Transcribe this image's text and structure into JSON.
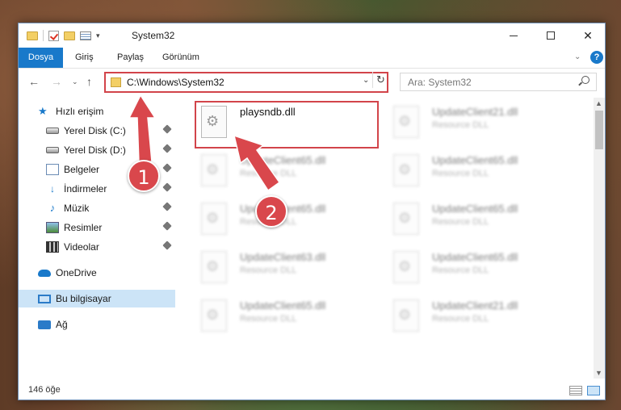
{
  "window": {
    "title": "System32",
    "quick_access_toolbar": [
      "folder-icon",
      "checkmark-icon",
      "folder-icon",
      "properties-icon"
    ]
  },
  "ribbon": {
    "tabs": [
      {
        "label": "Dosya",
        "active": true
      },
      {
        "label": "Giriş"
      },
      {
        "label": "Paylaş"
      },
      {
        "label": "Görünüm"
      }
    ],
    "help": "?"
  },
  "nav": {
    "address": "C:\\Windows\\System32",
    "search_placeholder": "Ara: System32"
  },
  "sidebar": {
    "quick_access": "Hızlı erişim",
    "items": [
      {
        "label": "Yerel Disk (C:)",
        "icon": "drive-icon"
      },
      {
        "label": "Yerel Disk (D:)",
        "icon": "drive-icon"
      },
      {
        "label": "Belgeler",
        "icon": "documents-icon"
      },
      {
        "label": "İndirmeler",
        "icon": "download-icon"
      },
      {
        "label": "Müzik",
        "icon": "music-icon"
      },
      {
        "label": "Resimler",
        "icon": "pictures-icon"
      },
      {
        "label": "Videolar",
        "icon": "videos-icon"
      }
    ],
    "onedrive": "OneDrive",
    "this_pc": "Bu bilgisayar",
    "network": "Ağ"
  },
  "files": {
    "highlighted": {
      "name": "playsndb.dll"
    },
    "others": [
      {
        "name": "UpdateClient21.dll",
        "type": "Resource DLL"
      },
      {
        "name": "UpdateClient65.dll",
        "type": "Resource DLL"
      },
      {
        "name": "UpdateClient65.dll",
        "type": "Resource DLL"
      },
      {
        "name": "UpdateClient65.dll",
        "type": "Resource DLL"
      },
      {
        "name": "UpdateClient65.dll",
        "type": "Resource DLL"
      },
      {
        "name": "UpdateClient63.dll",
        "type": "Resource DLL"
      },
      {
        "name": "UpdateClient65.dll",
        "type": "Resource DLL"
      },
      {
        "name": "UpdateClient65.dll",
        "type": "Resource DLL"
      },
      {
        "name": "UpdateClient21.dll",
        "type": "Resource DLL"
      }
    ]
  },
  "status": {
    "item_count": "146 öğe"
  },
  "annotations": {
    "step1": "1",
    "step2": "2",
    "color": "#d9474c"
  }
}
